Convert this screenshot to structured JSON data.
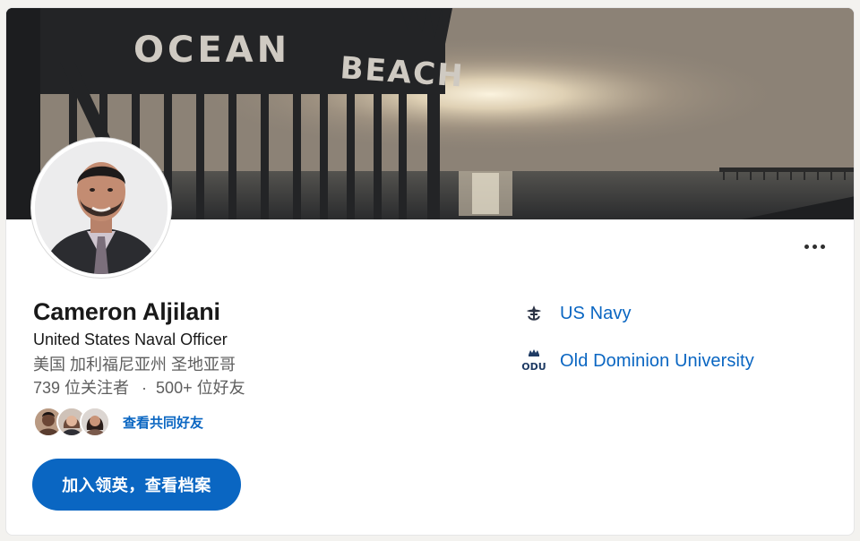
{
  "cover": {
    "sign_left": "OCEAN",
    "sign_right": "BEACH"
  },
  "profile": {
    "name": "Cameron Aljilani",
    "headline": "United States Naval Officer",
    "location": "美国 加利福尼亚州 圣地亚哥",
    "followers": "739 位关注者",
    "separator": "·",
    "connections": "500+ 位好友"
  },
  "mutual": {
    "link_label": "查看共同好友",
    "avatar_count": 3
  },
  "actions": {
    "join_label": "加入领英，查看档案",
    "more_icon": "ellipsis-icon"
  },
  "organizations": [
    {
      "name": "US Navy",
      "icon": "us-navy-logo-icon"
    },
    {
      "name": "Old Dominion University",
      "icon": "odu-logo-icon",
      "logo_text": "ODU"
    }
  ],
  "colors": {
    "accent": "#0a66c2",
    "text_primary": "#191919",
    "text_secondary": "#5e5e5e",
    "background": "#f3f2ef"
  }
}
